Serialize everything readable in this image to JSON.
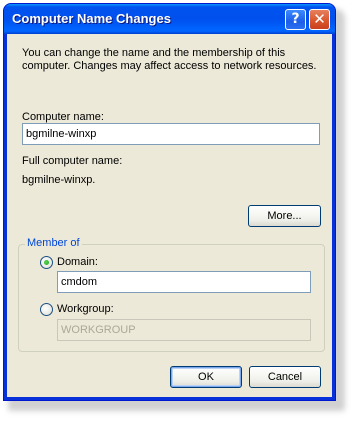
{
  "window": {
    "title": "Computer Name Changes",
    "help_glyph": "?",
    "close_glyph": "✕"
  },
  "description": "You can change the name and the membership of this computer. Changes may affect access to network resources.",
  "computer_name": {
    "label": "Computer name:",
    "value": "bgmilne-winxp"
  },
  "full_name": {
    "label": "Full computer name:",
    "value": "bgmilne-winxp."
  },
  "more_button": "More...",
  "member_of": {
    "legend": "Member of",
    "domain": {
      "label": "Domain:",
      "value": "cmdom",
      "selected": true
    },
    "workgroup": {
      "label": "Workgroup:",
      "value": "WORKGROUP",
      "selected": false
    }
  },
  "buttons": {
    "ok": "OK",
    "cancel": "Cancel"
  }
}
